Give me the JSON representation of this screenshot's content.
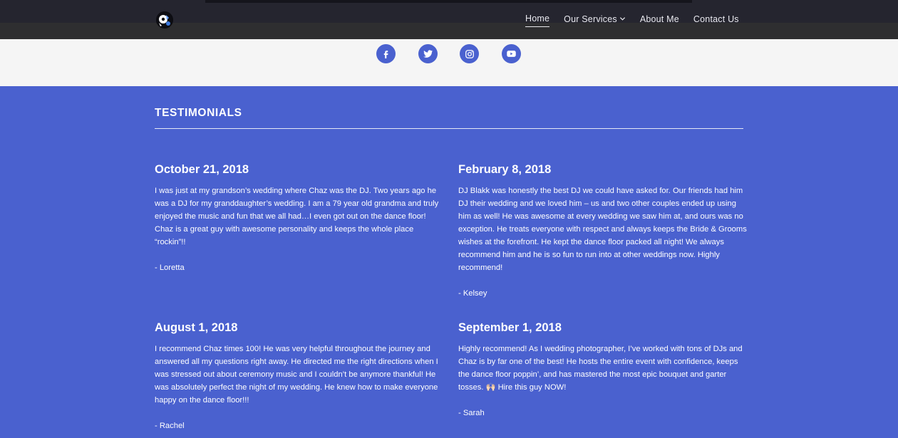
{
  "header": {
    "logo_icon": "dj-turntable-logo-icon",
    "nav": [
      {
        "label": "Home",
        "active": true
      },
      {
        "label": "Our Services",
        "has_dropdown": true
      },
      {
        "label": "About Me"
      },
      {
        "label": "Contact Us"
      }
    ]
  },
  "social": {
    "icons": [
      "facebook-icon",
      "twitter-icon",
      "instagram-icon",
      "youtube-icon"
    ],
    "accent": "#4a61cf"
  },
  "testimonials": {
    "title": "TESTIMONIALS",
    "items": [
      {
        "date": "October 21, 2018",
        "text": "I was just at my grandson’s wedding where Chaz was the DJ. Two years ago he was a DJ for my granddaughter’s wedding. I am a 79 year old grandma and truly enjoyed the music and fun that we all had…I even got out on the dance floor! Chaz is a great guy with awesome personality and keeps the whole place “rockin”!!",
        "author": "- Loretta"
      },
      {
        "date": "February 8, 2018",
        "text": "DJ Blakk was honestly the best DJ we could have asked for. Our friends had him DJ their wedding and we loved him – us and two other couples ended up using him as well! He was awesome at every wedding we saw him at, and ours was no exception. He treats everyone with respect and always keeps the Bride & Grooms wishes at the forefront. He kept the dance floor packed all night! We always recommend him and he is so fun to run into at other weddings now. Highly recommend!",
        "author": "- Kelsey"
      },
      {
        "date": "August 1, 2018",
        "text": "I recommend Chaz times 100! He was very helpful throughout the journey and answered all my questions right away. He directed me the right directions when I was stressed out about ceremony music and I couldn’t be anymore thankful! He was absolutely perfect the night of my wedding. He knew how to make everyone happy on the dance floor!!!",
        "author": "- Rachel"
      },
      {
        "date": "September 1, 2018",
        "text": "Highly recommend! As I wedding photographer, I’ve worked with tons of DJs and Chaz is by far one of the best! He hosts the entire event with confidence, keeps the dance floor poppin’, and has mastered the most epic bouquet and garter tosses. 🙌🏻 Hire this guy NOW!",
        "author": "- Sarah"
      }
    ]
  },
  "colors": {
    "background": "#4a61cf",
    "header": "#25252f",
    "social_band": "#f5f5f5"
  }
}
